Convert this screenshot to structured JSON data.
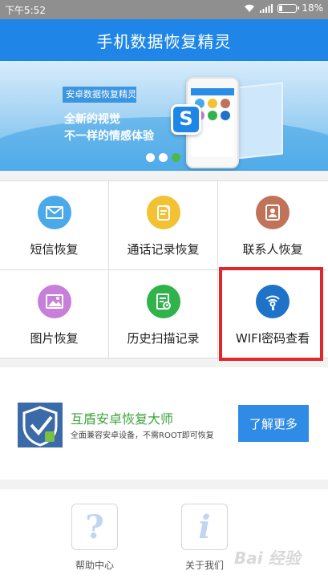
{
  "status_bar": {
    "time": "下午5:52",
    "battery": "18%",
    "battery_level": 0.18
  },
  "header": {
    "title": "手机数据恢复精灵"
  },
  "banner": {
    "tag": "安卓数据恢复精灵",
    "line1": "全新的视觉",
    "line2": "不一样的情感体验",
    "slides": 3,
    "active_slide": 3
  },
  "features": [
    {
      "label": "短信恢复",
      "icon": "message-icon",
      "color": "#4aa9ea"
    },
    {
      "label": "通话记录恢复",
      "icon": "call-log-icon",
      "color": "#f2c232"
    },
    {
      "label": "联系人恢复",
      "icon": "contacts-icon",
      "color": "#c1735a"
    },
    {
      "label": "图片恢复",
      "icon": "image-icon",
      "color": "#c77fd9"
    },
    {
      "label": "历史扫描记录",
      "icon": "scan-history-icon",
      "color": "#2fb34a"
    },
    {
      "label": "WIFI密码查看",
      "icon": "wifi-key-icon",
      "color": "#1e73c9"
    }
  ],
  "promo": {
    "title": "互盾安卓恢复大师",
    "subtitle": "全面兼容安卓设备，不需ROOT即可恢复",
    "button": "了解更多"
  },
  "bottom_nav": [
    {
      "label": "帮助中心",
      "icon": "help-icon"
    },
    {
      "label": "关于我们",
      "icon": "info-icon"
    }
  ],
  "watermark": "Bai 经验"
}
